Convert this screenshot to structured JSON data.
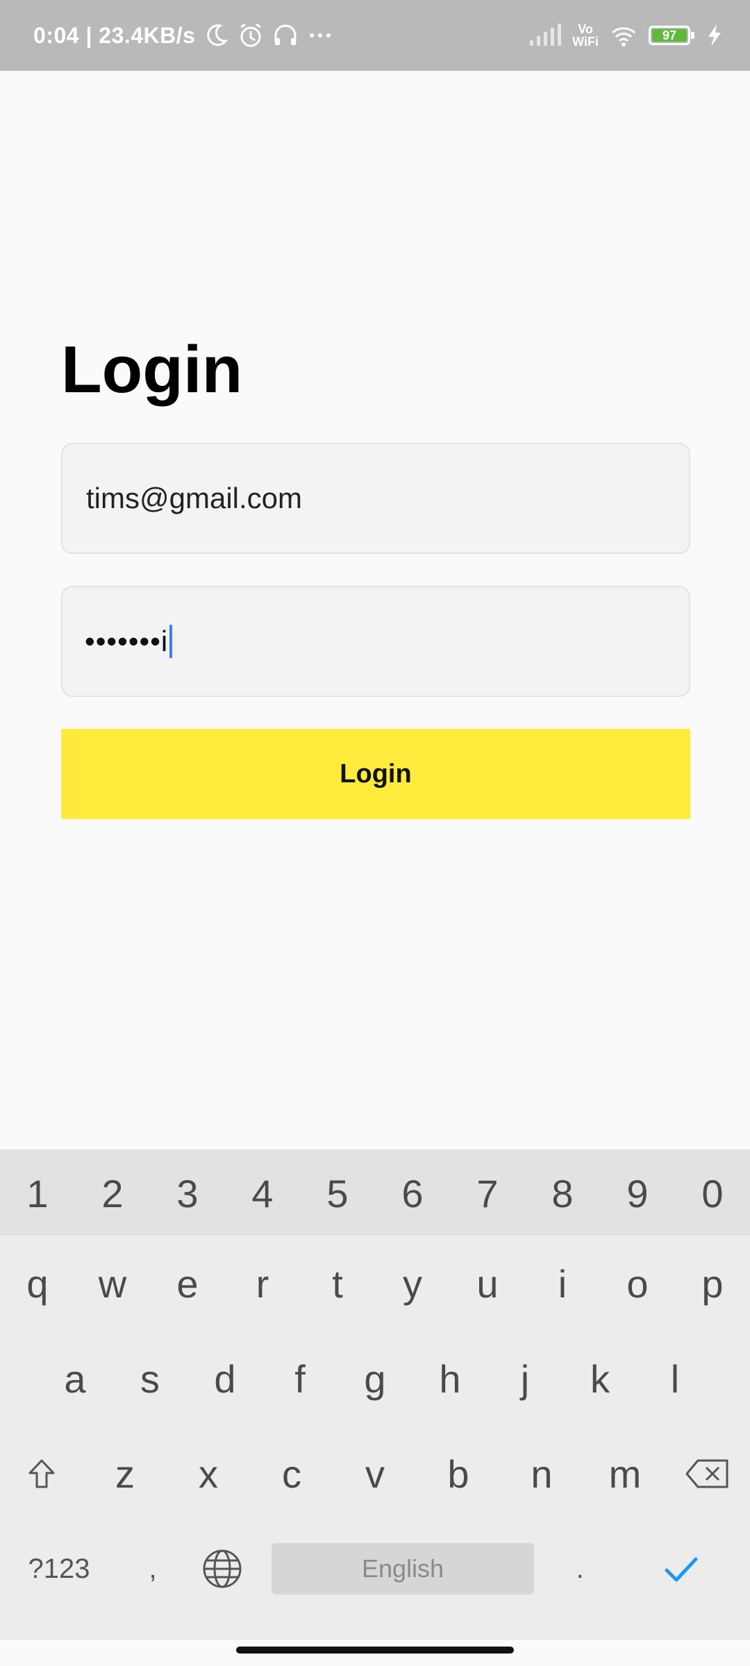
{
  "status_bar": {
    "time_speed": "0:04 | 23.4KB/s",
    "icons": [
      "moon-icon",
      "alarm-icon",
      "headphones-icon",
      "more-icon"
    ],
    "right_icons": [
      "signal-icon",
      "vowifi-icon",
      "wifi-icon",
      "battery-icon",
      "charging-icon"
    ],
    "vowifi_label": "Vo\nWiFi",
    "battery_level": "97"
  },
  "login": {
    "title": "Login",
    "email_value": "tims@gmail.com",
    "password_masked": "•••••••i",
    "button_label": "Login",
    "button_color": "#ffeb3b"
  },
  "keyboard": {
    "numbers": [
      "1",
      "2",
      "3",
      "4",
      "5",
      "6",
      "7",
      "8",
      "9",
      "0"
    ],
    "row1": [
      "q",
      "w",
      "e",
      "r",
      "t",
      "y",
      "u",
      "i",
      "o",
      "p"
    ],
    "row2": [
      "a",
      "s",
      "d",
      "f",
      "g",
      "h",
      "j",
      "k",
      "l"
    ],
    "row3": [
      "z",
      "x",
      "c",
      "v",
      "b",
      "n",
      "m"
    ],
    "symbols_key": "?123",
    "comma_key": ",",
    "space_label": "English",
    "period_key": ".",
    "accent_color": "#2196f3"
  }
}
